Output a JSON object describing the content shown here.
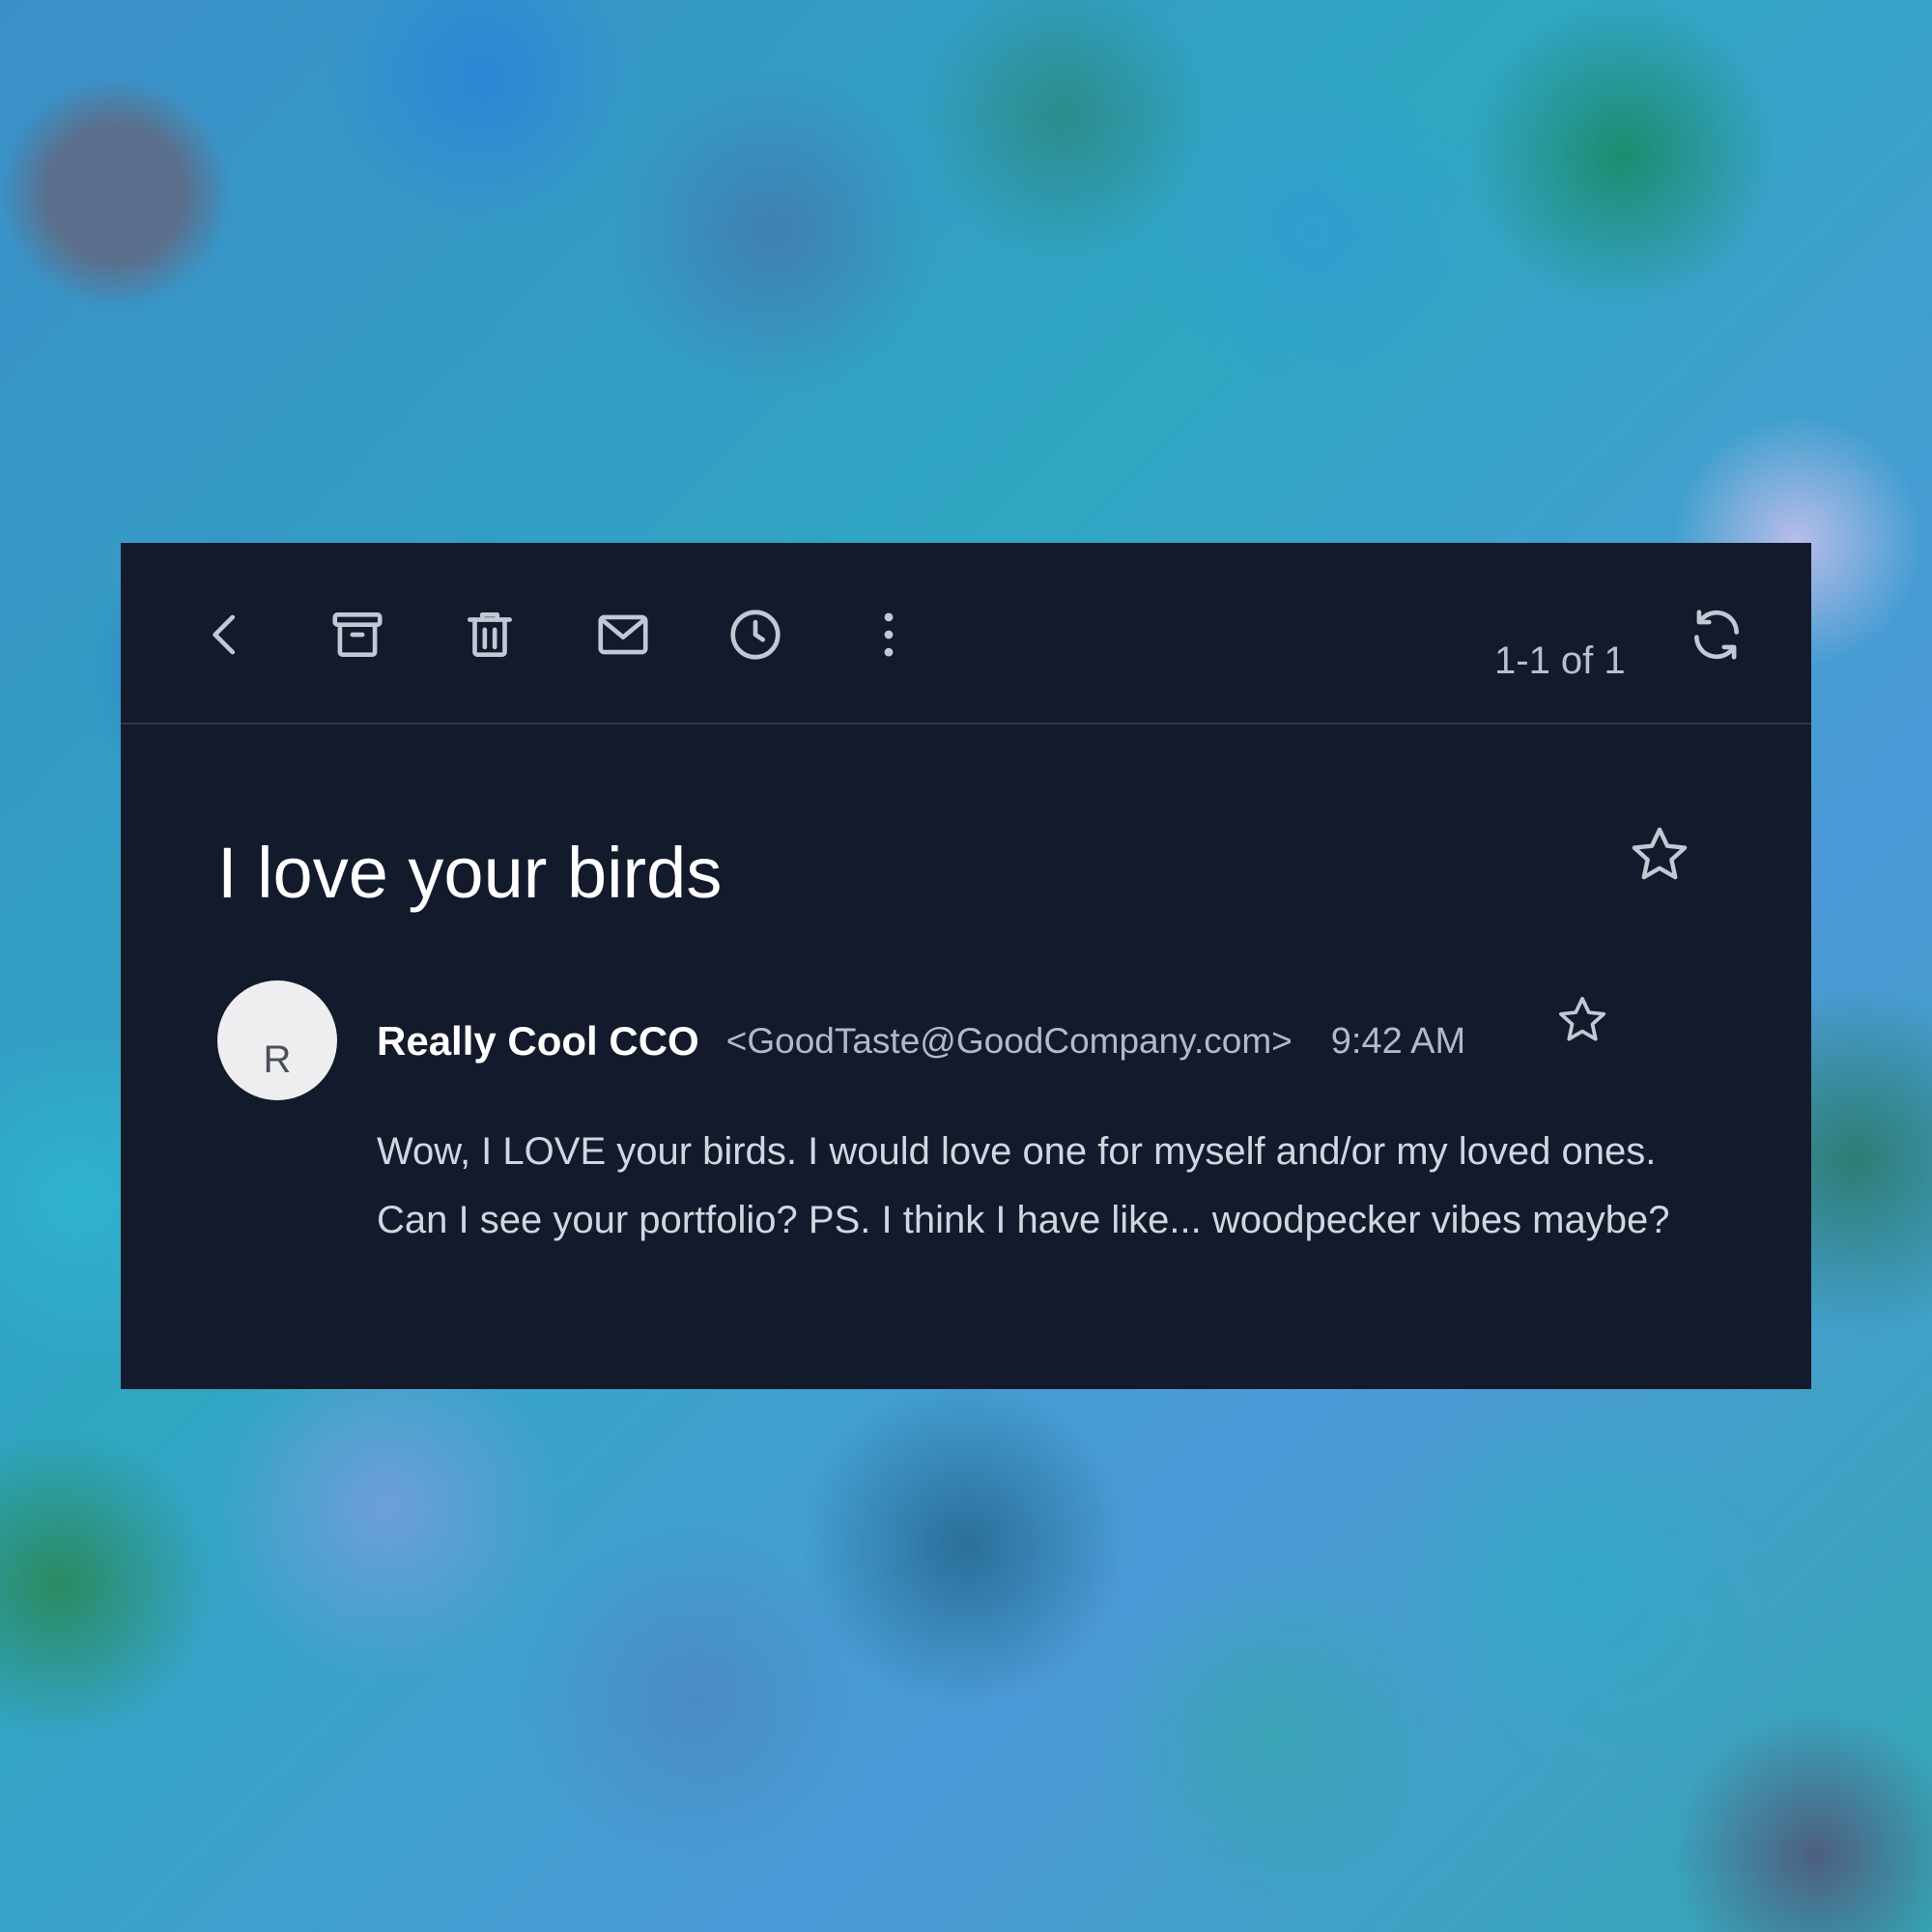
{
  "toolbar": {
    "buttons": [
      {
        "name": "back",
        "icon": "chevron-left-icon"
      },
      {
        "name": "archive",
        "icon": "archive-icon"
      },
      {
        "name": "delete",
        "icon": "trash-icon"
      },
      {
        "name": "mark-unread",
        "icon": "mail-icon"
      },
      {
        "name": "snooze",
        "icon": "clock-icon"
      },
      {
        "name": "more",
        "icon": "more-vertical-icon"
      }
    ],
    "page_count": "1-1 of 1",
    "refresh_icon": "refresh-icon"
  },
  "email": {
    "subject": "I love your birds",
    "subject_star_icon": "star-outline-icon",
    "avatar_initial": "R",
    "sender_name": "Really Cool CCO",
    "sender_email": "<GoodTaste@GoodCompany.com>",
    "time": "9:42 AM",
    "message_star_icon": "star-outline-icon",
    "body": "Wow, I LOVE your birds. I would love one for myself and/or my loved ones. Can I see your portfolio? PS. I think I have like... woodpecker vibes maybe?"
  },
  "colors": {
    "panel_background": "#131a2b",
    "icon_color": "#c3c8d2",
    "subject_color": "#ffffff",
    "muted_text": "#b3b9c6"
  }
}
